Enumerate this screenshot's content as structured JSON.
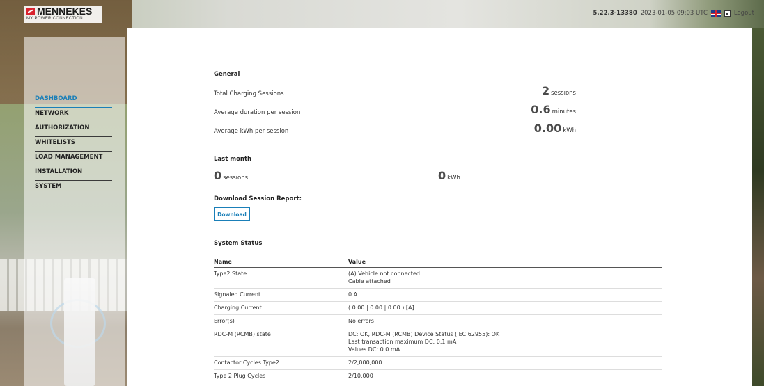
{
  "header": {
    "logo_text": "MENNEKES",
    "logo_tagline": "MY POWER CONNECTION",
    "version": "5.22.3-13380",
    "datetime": "2023-01-05 09:03 UTC",
    "language_icon": "uk-flag-icon",
    "logout_label": "Logout"
  },
  "sidebar": {
    "items": [
      {
        "label": "DASHBOARD",
        "active": true
      },
      {
        "label": "NETWORK"
      },
      {
        "label": "AUTHORIZATION"
      },
      {
        "label": "WHITELISTS"
      },
      {
        "label": "LOAD MANAGEMENT"
      },
      {
        "label": "INSTALLATION"
      },
      {
        "label": "SYSTEM"
      }
    ]
  },
  "general": {
    "title": "General",
    "rows": [
      {
        "label": "Total Charging Sessions",
        "value": "2",
        "unit": "sessions"
      },
      {
        "label": "Average duration per session",
        "value": "0.6",
        "unit": "minutes"
      },
      {
        "label": "Average kWh per session",
        "value": "0.00",
        "unit": "kWh"
      }
    ]
  },
  "last_month": {
    "title": "Last month",
    "sessions_value": "0",
    "sessions_unit": "sessions",
    "kwh_value": "0",
    "kwh_unit": "kWh"
  },
  "download": {
    "title": "Download Session Report:",
    "button_label": "Download"
  },
  "system_status": {
    "title": "System Status",
    "columns": [
      "Name",
      "Value"
    ],
    "rows": [
      {
        "name": "Type2 State",
        "value": [
          "(A) Vehicle not connected",
          "Cable attached"
        ]
      },
      {
        "name": "Signaled Current",
        "value": [
          "0 A"
        ]
      },
      {
        "name": "Charging Current",
        "value": [
          "( 0.00 | 0.00 | 0.00 ) [A]"
        ]
      },
      {
        "name": "Error(s)",
        "value": [
          "No errors"
        ]
      },
      {
        "name": "RDC-M (RCMB) state",
        "value": [
          "DC: OK, RDC-M (RCMB) Device Status (IEC 62955): OK",
          "Last transaction maximum DC: 0.1 mA",
          "Values DC: 0.0 mA"
        ]
      },
      {
        "name": "Contactor Cycles Type2",
        "value": [
          "2/2,000,000"
        ]
      },
      {
        "name": "Type 2 Plug Cycles",
        "value": [
          "2/10,000"
        ]
      }
    ]
  },
  "colors": {
    "accent": "#1a7fb8",
    "brand_red": "#d9232f"
  }
}
